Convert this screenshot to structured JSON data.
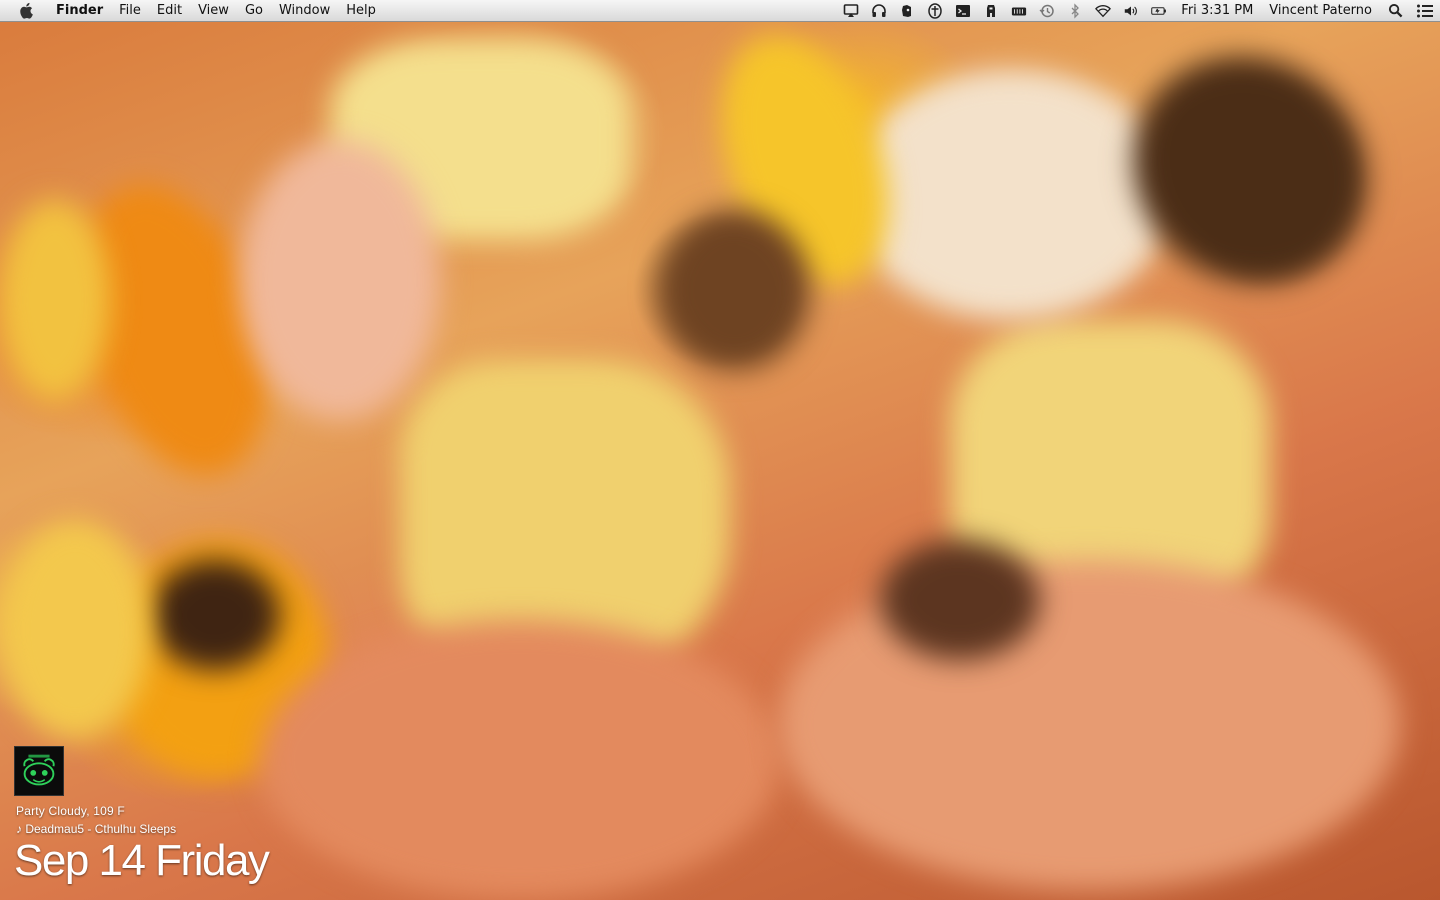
{
  "menubar": {
    "app_name": "Finder",
    "menus": [
      "File",
      "Edit",
      "View",
      "Go",
      "Window",
      "Help"
    ],
    "status_icons": [
      "airplay-icon",
      "headphones-icon",
      "evernote-icon",
      "accessibility-icon",
      "terminal-icon",
      "alfred-icon",
      "battery-widget-icon",
      "time-machine-icon",
      "bluetooth-icon",
      "wifi-icon",
      "volume-icon",
      "battery-icon"
    ],
    "clock": "Fri 3:31 PM",
    "user": "Vincent Paterno"
  },
  "widget": {
    "weather": "Party Cloudy, 109 F",
    "now_playing": "♪ Deadmau5 - Cthulhu Sleeps",
    "date": "Sep 14 Friday"
  }
}
